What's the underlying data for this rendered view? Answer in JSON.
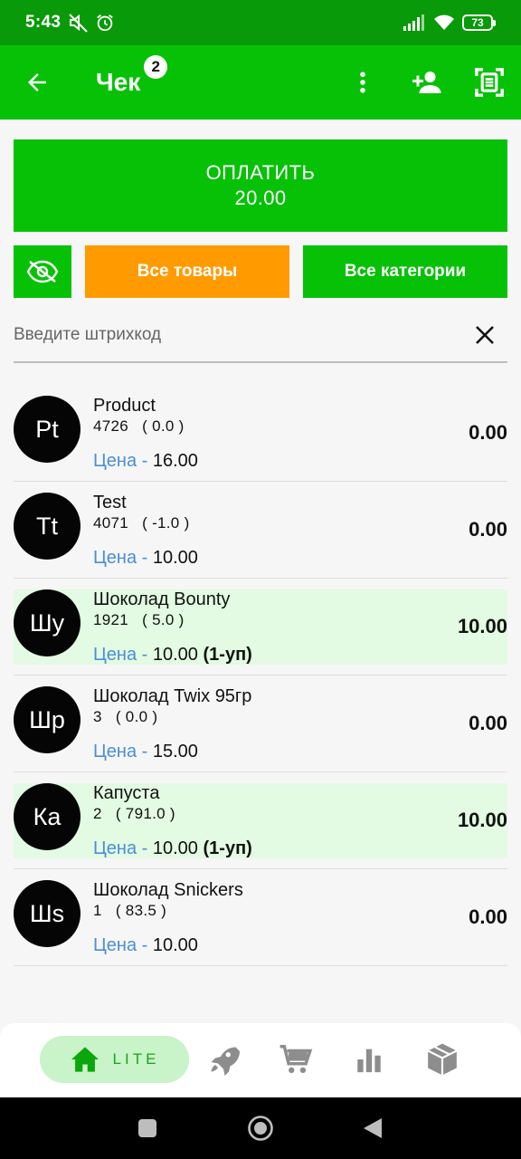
{
  "status": {
    "time": "5:43",
    "battery": "73"
  },
  "appbar": {
    "title": "Чек",
    "badge": "2"
  },
  "pay": {
    "label": "ОПЛАТИТЬ",
    "amount": "20.00"
  },
  "buttons": {
    "all_goods": "Все товары",
    "all_categories": "Все категории"
  },
  "search": {
    "placeholder": "Введите штрихкод",
    "value": ""
  },
  "items": [
    {
      "avatar": "Pt",
      "name": "Product",
      "code": "4726   ( 0.0 )",
      "price_label": "Цена -",
      "price": "16.00",
      "pack": "",
      "total": "0.00",
      "highlighted": false
    },
    {
      "avatar": "Tt",
      "name": "Test",
      "code": "4071   ( -1.0 )",
      "price_label": "Цена -",
      "price": "10.00",
      "pack": "",
      "total": "0.00",
      "highlighted": false
    },
    {
      "avatar": "Шу",
      "name": "Шоколад Bounty",
      "code": "1921   ( 5.0 )",
      "price_label": "Цена -",
      "price": "10.00",
      "pack": "(1-уп)",
      "total": "10.00",
      "highlighted": true
    },
    {
      "avatar": "Шр",
      "name": "Шоколад Twix 95гр",
      "code": "3   ( 0.0 )",
      "price_label": "Цена -",
      "price": "15.00",
      "pack": "",
      "total": "0.00",
      "highlighted": false
    },
    {
      "avatar": "Ка",
      "name": "Капуста",
      "code": "2   ( 791.0 )",
      "price_label": "Цена -",
      "price": "10.00",
      "pack": "(1-уп)",
      "total": "10.00",
      "highlighted": true
    },
    {
      "avatar": "Шs",
      "name": "Шоколад Snickers",
      "code": "1   ( 83.5 )",
      "price_label": "Цена -",
      "price": "10.00",
      "pack": "",
      "total": "0.00",
      "highlighted": false
    }
  ],
  "bottom_nav": {
    "home_label": "LITE",
    "icons": [
      "home-icon",
      "rocket-icon",
      "cart-icon",
      "chart-icon",
      "box-icon"
    ]
  },
  "colors": {
    "primary": "#07c107",
    "status_bar": "#089a08",
    "orange": "#ff9b00",
    "highlight": "#e2fbe2",
    "price_label": "#4a8ed8"
  }
}
